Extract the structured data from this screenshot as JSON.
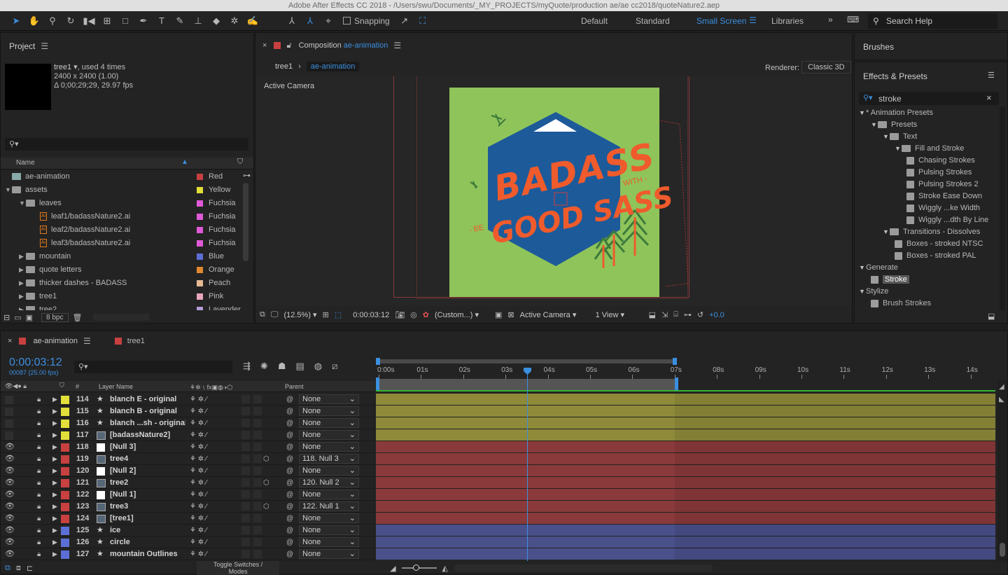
{
  "window_title": "Adobe After Effects CC 2018 - /Users/swu/Documents/_MY_PROJECTS/myQuote/production ae/ae cc2018/quoteNature2.aep",
  "toolbar": {
    "snapping_label": "Snapping",
    "workspaces": [
      "Default",
      "Standard",
      "Small Screen",
      "Libraries"
    ],
    "active_workspace": "Small Screen",
    "search_placeholder": "Search Help"
  },
  "project": {
    "title": "Project",
    "item_name": "tree1",
    "item_used": ", used 4 times",
    "item_size": "2400 x 2400 (1.00)",
    "item_duration": "Δ 0;00;29;29, 29.97 fps",
    "col_name": "Name",
    "bpc": "8 bpc",
    "items": [
      {
        "name": "ae-animation",
        "label": "Red",
        "color": "#c94040",
        "indent": 0,
        "type": "comp",
        "tri": ""
      },
      {
        "name": "assets",
        "label": "Yellow",
        "color": "#e2df3a",
        "indent": 0,
        "type": "folder",
        "tri": "▼"
      },
      {
        "name": "leaves",
        "label": "Fuchsia",
        "color": "#e05ad8",
        "indent": 1,
        "type": "folder",
        "tri": "▼"
      },
      {
        "name": "leaf1/badassNature2.ai",
        "label": "Fuchsia",
        "color": "#e05ad8",
        "indent": 2,
        "type": "ai",
        "tri": ""
      },
      {
        "name": "leaf2/badassNature2.ai",
        "label": "Fuchsia",
        "color": "#e05ad8",
        "indent": 2,
        "type": "ai",
        "tri": ""
      },
      {
        "name": "leaf3/badassNature2.ai",
        "label": "Fuchsia",
        "color": "#e05ad8",
        "indent": 2,
        "type": "ai",
        "tri": ""
      },
      {
        "name": "mountain",
        "label": "Blue",
        "color": "#5c6fd6",
        "indent": 1,
        "type": "folder",
        "tri": "▶"
      },
      {
        "name": "quote letters",
        "label": "Orange",
        "color": "#e0892e",
        "indent": 1,
        "type": "folder",
        "tri": "▶"
      },
      {
        "name": "thicker dashes - BADASS",
        "label": "Peach",
        "color": "#e6b995",
        "indent": 1,
        "type": "folder",
        "tri": "▶"
      },
      {
        "name": "tree1",
        "label": "Pink",
        "color": "#e8a6b9",
        "indent": 1,
        "type": "folder",
        "tri": "▶"
      },
      {
        "name": "tree2",
        "label": "Lavender",
        "color": "#b09bd6",
        "indent": 1,
        "type": "folder",
        "tri": "▶"
      }
    ]
  },
  "composition": {
    "title_prefix": "Composition",
    "name": "ae-animation",
    "breadcrumb_parent": "tree1",
    "breadcrumb_current": "ae-animation",
    "renderer_label": "Renderer:",
    "renderer_value": "Classic 3D",
    "active_camera": "Active Camera",
    "artwork_text1": "BADASS",
    "artwork_text2": "GOOD SASS",
    "artwork_text_be": "- BE",
    "artwork_text_with": "WITH -",
    "footer": {
      "zoom": "(12.5%)",
      "time": "0:00:03:12",
      "resolution": "(Custom...)",
      "camera": "Active Camera",
      "view": "1 View",
      "exposure": "+0.0"
    }
  },
  "brushes": {
    "title": "Brushes"
  },
  "effects": {
    "title": "Effects & Presets",
    "search_value": "stroke",
    "tree": [
      {
        "label": "* Animation Presets",
        "level": 0,
        "tri": "▼",
        "icon": "none"
      },
      {
        "label": "Presets",
        "level": 1,
        "tri": "▼",
        "icon": "folder"
      },
      {
        "label": "Text",
        "level": 2,
        "tri": "▼",
        "icon": "folder"
      },
      {
        "label": "Fill and Stroke",
        "level": 3,
        "tri": "▼",
        "icon": "folder"
      },
      {
        "label": "Chasing Strokes",
        "level": 4,
        "tri": "",
        "icon": "preset"
      },
      {
        "label": "Pulsing Strokes",
        "level": 4,
        "tri": "",
        "icon": "preset"
      },
      {
        "label": "Pulsing Strokes 2",
        "level": 4,
        "tri": "",
        "icon": "preset"
      },
      {
        "label": "Stroke Ease Down",
        "level": 4,
        "tri": "",
        "icon": "preset"
      },
      {
        "label": "Wiggly ...ke Width",
        "level": 4,
        "tri": "",
        "icon": "preset"
      },
      {
        "label": "Wiggly ...dth By Line",
        "level": 4,
        "tri": "",
        "icon": "preset"
      },
      {
        "label": "Transitions - Dissolves",
        "level": 2,
        "tri": "▼",
        "icon": "folder"
      },
      {
        "label": "Boxes - stroked NTSC",
        "level": 3,
        "tri": "",
        "icon": "preset"
      },
      {
        "label": "Boxes - stroked PAL",
        "level": 3,
        "tri": "",
        "icon": "preset"
      },
      {
        "label": "Generate",
        "level": 0,
        "tri": "▼",
        "icon": "none"
      },
      {
        "label": "Stroke",
        "level": 1,
        "tri": "",
        "icon": "preset",
        "selected": true
      },
      {
        "label": "Stylize",
        "level": 0,
        "tri": "▼",
        "icon": "none"
      },
      {
        "label": "Brush Strokes",
        "level": 1,
        "tri": "",
        "icon": "preset"
      }
    ]
  },
  "timeline": {
    "tabs": [
      "ae-animation",
      "tree1"
    ],
    "timecode": "0:00:03:12",
    "frames": "00087 (25.00 fps)",
    "col_num": "#",
    "col_layer": "Layer Name",
    "col_parent": "Parent",
    "toggle_label": "Toggle Switches / Modes",
    "ruler": [
      "0:00s",
      "01s",
      "02s",
      "03s",
      "04s",
      "05s",
      "06s",
      "07s",
      "08s",
      "09s",
      "10s",
      "11s",
      "12s",
      "13s",
      "14s"
    ],
    "layers": [
      {
        "num": "114",
        "name": "blanch E - original",
        "color": "#e2df3a",
        "type": "star",
        "parent": "None",
        "eye": false,
        "bar": "#8f8a3a"
      },
      {
        "num": "115",
        "name": "blanch B - original",
        "color": "#e2df3a",
        "type": "star",
        "parent": "None",
        "eye": false,
        "bar": "#8f8a3a"
      },
      {
        "num": "116",
        "name": "blanch ...sh - original",
        "color": "#e2df3a",
        "type": "star",
        "parent": "None",
        "eye": false,
        "bar": "#8f8a3a"
      },
      {
        "num": "117",
        "name": "[badassNature2]",
        "color": "#e2df3a",
        "type": "comp",
        "parent": "None",
        "eye": false,
        "bar": "#8f8a3a"
      },
      {
        "num": "118",
        "name": "[Null 3]",
        "color": "#c94040",
        "type": "null",
        "parent": "None",
        "eye": true,
        "bar": "#8a3a3a"
      },
      {
        "num": "119",
        "name": "tree4",
        "color": "#c94040",
        "type": "comp",
        "parent": "118. Null 3",
        "eye": true,
        "bar": "#8a3a3a"
      },
      {
        "num": "120",
        "name": "[Null 2]",
        "color": "#c94040",
        "type": "null",
        "parent": "None",
        "eye": true,
        "bar": "#8a3a3a"
      },
      {
        "num": "121",
        "name": "tree2",
        "color": "#c94040",
        "type": "comp",
        "parent": "120. Null 2",
        "eye": true,
        "bar": "#8a3a3a"
      },
      {
        "num": "122",
        "name": "[Null 1]",
        "color": "#c94040",
        "type": "null",
        "parent": "None",
        "eye": true,
        "bar": "#8a3a3a"
      },
      {
        "num": "123",
        "name": "tree3",
        "color": "#c94040",
        "type": "comp",
        "parent": "122. Null 1",
        "eye": true,
        "bar": "#8a3a3a"
      },
      {
        "num": "124",
        "name": "[tree1]",
        "color": "#c94040",
        "type": "comp",
        "parent": "None",
        "eye": true,
        "bar": "#8a3a3a"
      },
      {
        "num": "125",
        "name": "ice",
        "color": "#5c6fd6",
        "type": "star",
        "parent": "None",
        "eye": true,
        "bar": "#4a508a"
      },
      {
        "num": "126",
        "name": "circle",
        "color": "#5c6fd6",
        "type": "star",
        "parent": "None",
        "eye": true,
        "bar": "#4a508a"
      },
      {
        "num": "127",
        "name": "mountain Outlines",
        "color": "#5c6fd6",
        "type": "star",
        "parent": "None",
        "eye": true,
        "bar": "#4a508a"
      }
    ]
  },
  "colors": {
    "accent": "#3b8fe0",
    "artboard": "#8fc45a",
    "hexagon": "#1d5a99",
    "lettering": "#ef5b2c",
    "trees": "#3c7a3c"
  }
}
